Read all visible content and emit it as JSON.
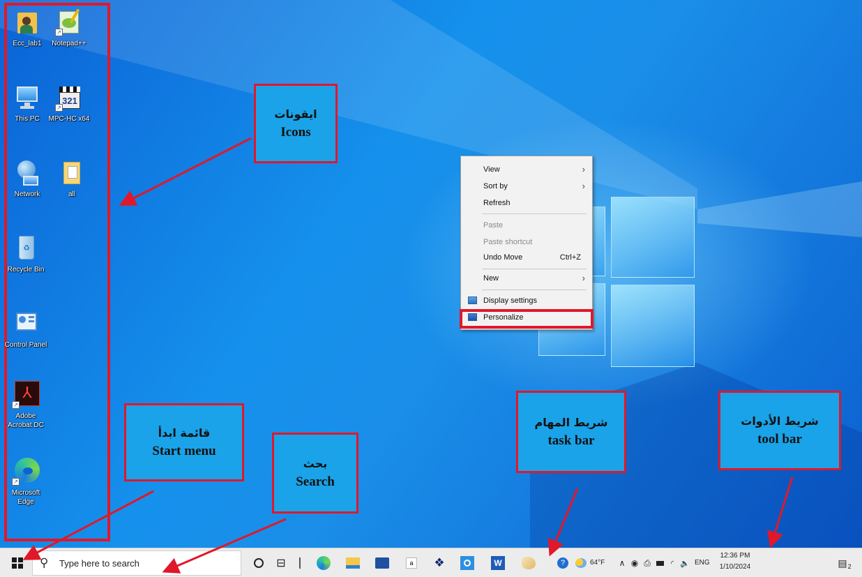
{
  "desktop": {
    "icons": [
      {
        "name": "ecc-lab1-icon",
        "label": "Ecc_lab1"
      },
      {
        "name": "notepad-plus-plus-icon",
        "label": "Notepad++"
      },
      {
        "name": "this-pc-icon",
        "label": "This PC"
      },
      {
        "name": "mpc-hc-icon",
        "label": "MPC-HC x64"
      },
      {
        "name": "network-icon",
        "label": "Network"
      },
      {
        "name": "all-folder-icon",
        "label": "all"
      },
      {
        "name": "recycle-bin-icon",
        "label": "Recycle Bin"
      },
      {
        "name": "control-panel-icon",
        "label": "Control Panel"
      },
      {
        "name": "adobe-acrobat-icon",
        "label": "Adobe Acrobat DC"
      },
      {
        "name": "microsoft-edge-icon",
        "label": "Microsoft Edge"
      }
    ]
  },
  "context_menu": {
    "view": "View",
    "sort_by": "Sort by",
    "refresh": "Refresh",
    "paste": "Paste",
    "paste_shortcut": "Paste shortcut",
    "undo_move": "Undo Move",
    "undo_shortcut": "Ctrl+Z",
    "new": "New",
    "display_settings": "Display settings",
    "personalize": "Personalize"
  },
  "callouts": {
    "icons": {
      "ar": "ايقونات",
      "en": "Icons"
    },
    "start_menu": {
      "ar": "قائمة ابدأ",
      "en": "Start menu"
    },
    "search": {
      "ar": "بحث",
      "en": "Search"
    },
    "task_bar": {
      "ar": "شريط المهام",
      "en": "task bar"
    },
    "tool_bar": {
      "ar": "شريط الأدوات",
      "en": "tool bar"
    }
  },
  "taskbar": {
    "search_placeholder": "Type here to search",
    "pinned_apps": [
      "cortana-circle-icon",
      "task-view-icon",
      "edge-icon",
      "file-explorer-icon",
      "mail-icon",
      "amazon-icon",
      "dropbox-icon",
      "cortana-app-icon",
      "word-icon",
      "paint-icon"
    ],
    "weather": "64°F",
    "language": "ENG",
    "time": "12:36 PM",
    "date": "1/10/2024",
    "notification_count": "2"
  },
  "colors": {
    "callout_bg": "#1aa3e8",
    "highlight_red": "#e0182a",
    "taskbar_bg": "#ececec"
  }
}
